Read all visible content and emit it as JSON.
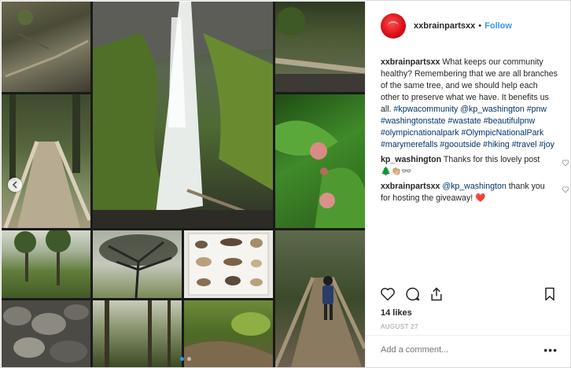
{
  "post": {
    "username": "xxbrainpartsxx",
    "separator": "•",
    "follow_label": "Follow",
    "caption_text": "What keeps our community healthy? Remembering that we are all branches of the same tree, and we should help each other to preserve what we have. It benefits us all.",
    "hashtags": [
      "#kpwacommunity",
      "@kp_washington",
      "#pnw",
      "#washingtonstate",
      "#wastate",
      "#beautifulpnw",
      "#olympicnationalpark",
      "#OlympicNationalPark",
      "#marymerefalls",
      "#gooutside",
      "#hiking",
      "#travel",
      "#joy"
    ],
    "comments": [
      {
        "user": "kp_washington",
        "text": "Thanks for this lovely post 🌲👏🏼👓"
      },
      {
        "user": "xxbrainpartsxx",
        "mention": "@kp_washington",
        "text": "thank you for hosting the giveaway! ❤️"
      }
    ],
    "likes": "14 likes",
    "date": "August 27",
    "add_comment_placeholder": "Add a comment...",
    "more_label": "•••"
  },
  "icons": {
    "avatar": "avatar-red-blob",
    "carousel_prev": "chevron-left-icon",
    "like": "heart-outline-icon",
    "comment": "speech-bubble-icon",
    "share": "share-upload-icon",
    "save": "bookmark-icon"
  },
  "colors": {
    "link": "#3897f0",
    "hashtag": "#003569",
    "muted": "#999999",
    "text": "#262626",
    "border": "#dbdbdb"
  }
}
